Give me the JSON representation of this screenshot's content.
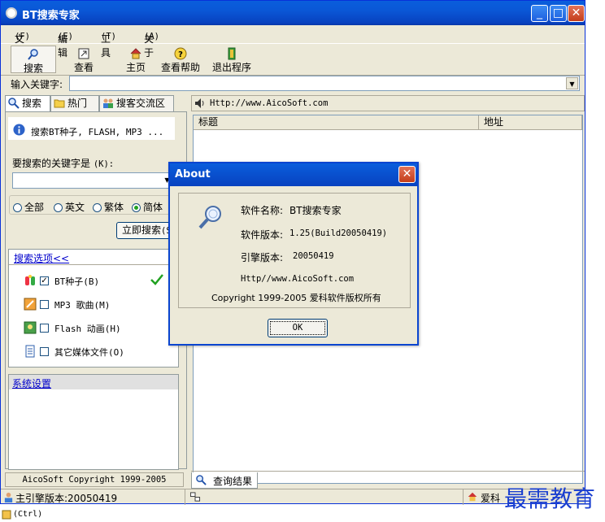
{
  "window": {
    "title": "BT搜索专家"
  },
  "window_controls": {
    "minimize": "_",
    "maximize": "□",
    "close": "✕"
  },
  "menu": [
    {
      "label": "文件",
      "key": "(F)"
    },
    {
      "label": "编辑",
      "key": "(E)"
    },
    {
      "label": "工具",
      "key": "(T)"
    },
    {
      "label": "关于",
      "key": "(A)"
    }
  ],
  "toolbar": {
    "search": "搜索",
    "view": "查看",
    "home": "主页",
    "help": "查看帮助",
    "exit": "退出程序"
  },
  "keyword_bar": {
    "label": "输入关键字:",
    "value": ""
  },
  "left_tabs": [
    {
      "label": "搜索",
      "icon": "magnifier-icon",
      "active": true
    },
    {
      "label": "热门",
      "icon": "folder-icon",
      "active": false
    },
    {
      "label": "搜客交流区",
      "icon": "users-icon",
      "active": false
    }
  ],
  "search_panel": {
    "info_text": "搜索BT种子, FLASH, MP3 ...",
    "keyword_label": "要搜索的关键字是",
    "keyword_key": "(K):",
    "keyword_value": "",
    "radios": [
      {
        "label": "全部",
        "selected": false
      },
      {
        "label": "英文",
        "selected": false
      },
      {
        "label": "繁体",
        "selected": false
      },
      {
        "label": "简体",
        "selected": true
      }
    ],
    "search_button": "立即搜索",
    "search_button_key": "(S)",
    "options_link": "搜索选项<<",
    "options": [
      {
        "label": "BT种子",
        "key": "(B)",
        "checked": true,
        "icon": "bt-seed-icon"
      },
      {
        "label": "MP3 歌曲",
        "key": "(M)",
        "checked": false,
        "icon": "mp3-icon"
      },
      {
        "label": "Flash 动画",
        "key": "(H)",
        "checked": false,
        "icon": "flash-icon"
      },
      {
        "label": "其它媒体文件",
        "key": "(O)",
        "checked": false,
        "icon": "document-icon"
      }
    ],
    "settings_link": "系统设置",
    "copyright": "AicoSoft Copyright 1999-2005"
  },
  "right_panel": {
    "url": "Http://www.AicoSoft.com",
    "columns": [
      "标题",
      "地址"
    ],
    "rows": [],
    "bottom_tab": "查询结果"
  },
  "statusbar": {
    "engine": "主引擎版本:20050419",
    "right_text": "爱科"
  },
  "about": {
    "title": "About",
    "name_label": "软件名称:",
    "name_value": "BT搜索专家",
    "version_label": "软件版本:",
    "version_value": "1.25(Build20050419)",
    "engine_label": "引擎版本:",
    "engine_value": "20050419",
    "url": "Http//www.AicoSoft.com",
    "copyright": "Copyright 1999-2005 爱科软件版权所有",
    "ok": "OK"
  },
  "taskbar": {
    "ctrl": "(Ctrl)"
  },
  "watermark": "最需教育",
  "colors": {
    "xp_blue": "#0A57D6",
    "close_red": "#D8542F",
    "check_green": "#21A121",
    "face": "#ECE9D8"
  }
}
